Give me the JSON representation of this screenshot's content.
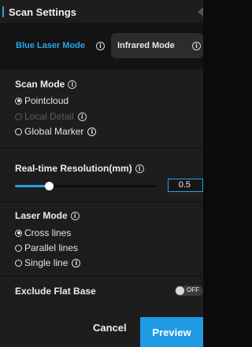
{
  "header": {
    "title": "Scan Settings"
  },
  "mode_tabs": [
    {
      "label": "Blue Laser Mode",
      "selected": true
    },
    {
      "label": "Infrared Mode",
      "selected": false
    }
  ],
  "scan_mode": {
    "title": "Scan Mode",
    "options": [
      {
        "label": "Pointcloud",
        "selected": true,
        "disabled": false,
        "has_info": false
      },
      {
        "label": "Local Detail",
        "selected": false,
        "disabled": true,
        "has_info": true
      },
      {
        "label": "Global Marker",
        "selected": false,
        "disabled": false,
        "has_info": true
      }
    ]
  },
  "resolution": {
    "title": "Real-time Resolution(mm)",
    "value": "0.5",
    "slider_fraction": 0.24
  },
  "laser_mode": {
    "title": "Laser Mode",
    "options": [
      {
        "label": "Cross lines",
        "selected": true,
        "has_info": false
      },
      {
        "label": "Parallel lines",
        "selected": false,
        "has_info": false
      },
      {
        "label": "Single line",
        "selected": false,
        "has_info": true
      }
    ]
  },
  "exclude_flat_base": {
    "label": "Exclude Flat Base",
    "toggle_text": "OFF",
    "on": false
  },
  "footer": {
    "cancel_label": "Cancel",
    "preview_label": "Preview"
  },
  "icons": {
    "info": "info-circle-icon"
  },
  "colors": {
    "accent": "#2aa0e8",
    "panel": "#1d1d1e",
    "primary_button": "#1f9be6"
  }
}
